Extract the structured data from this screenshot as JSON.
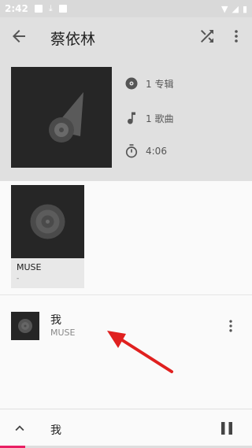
{
  "status_bar": {
    "time": "2:42"
  },
  "toolbar": {
    "title": "蔡依林"
  },
  "artist_info": {
    "albums": "1 专辑",
    "songs": "1 歌曲",
    "duration": "4:06"
  },
  "albums": [
    {
      "title": "MUSE",
      "subtitle": "-"
    }
  ],
  "songs": [
    {
      "title": "我",
      "album": "MUSE"
    }
  ],
  "mini_player": {
    "title": "我",
    "progress": 0.1
  },
  "colors": {
    "accent": "#e91e63",
    "annotation": "#e0201f"
  }
}
